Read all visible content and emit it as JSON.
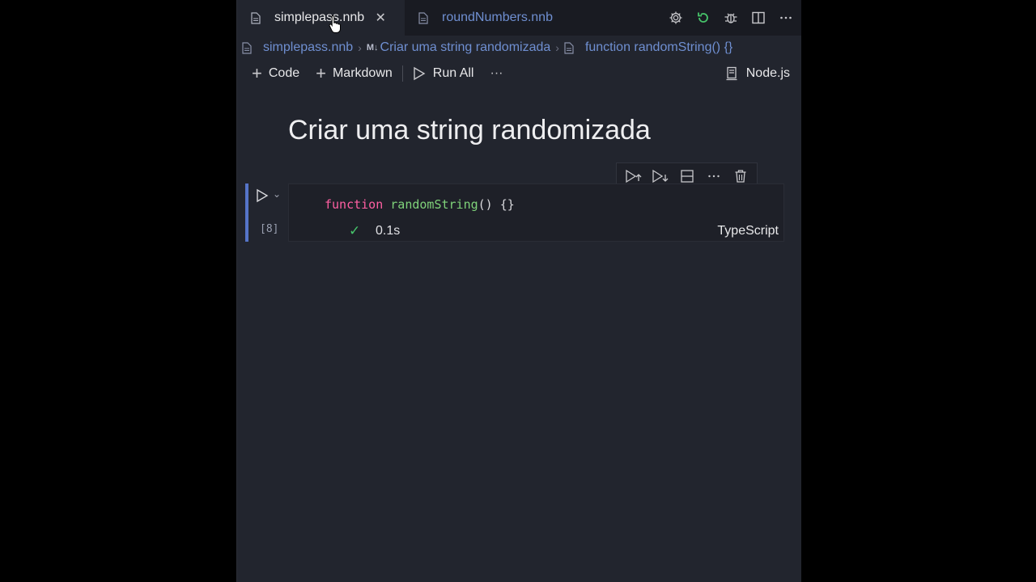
{
  "tabs": [
    {
      "label": "simplepass.nnb",
      "active": true,
      "close": "✕"
    },
    {
      "label": "roundNumbers.nnb",
      "active": false
    }
  ],
  "breadcrumb": {
    "file": "simplepass.nnb",
    "md_badge": "M↓",
    "section": "Criar uma string randomizada",
    "symbol": "function randomString() {}"
  },
  "toolbar": {
    "code_label": "Code",
    "markdown_label": "Markdown",
    "run_all_label": "Run All",
    "more": "···",
    "kernel_label": "Node.js"
  },
  "notebook": {
    "heading": "Criar uma string randomizada",
    "cell": {
      "code_keyword": "function",
      "code_name": "randomString",
      "code_rest": "() {}",
      "exec_count": "[8]",
      "exec_time": "0.1s",
      "language": "TypeScript"
    }
  },
  "colors": {
    "accent": "#5574c8",
    "tab_link": "#6f8fd1",
    "keyword": "#ff5fa2",
    "function": "#7fd27a",
    "success": "#46c46a"
  }
}
